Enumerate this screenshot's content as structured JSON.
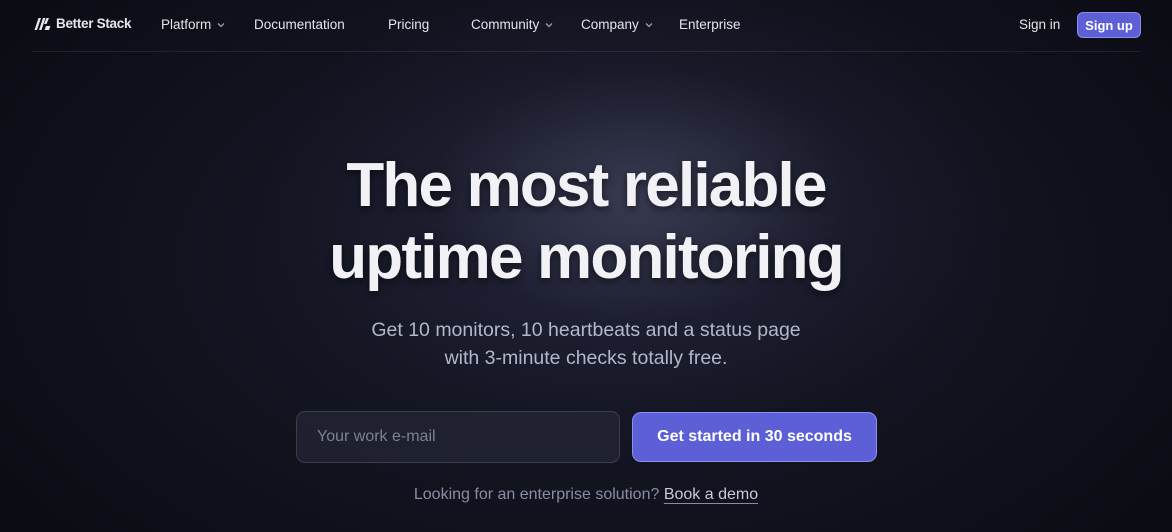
{
  "brand": {
    "name": "Better Stack",
    "logo_icon": "betterstack-logo-icon"
  },
  "nav": {
    "items": [
      {
        "label": "Platform",
        "has_dropdown": true
      },
      {
        "label": "Documentation",
        "has_dropdown": false
      },
      {
        "label": "Pricing",
        "has_dropdown": false
      },
      {
        "label": "Community",
        "has_dropdown": true
      },
      {
        "label": "Company",
        "has_dropdown": true
      },
      {
        "label": "Enterprise",
        "has_dropdown": false
      }
    ],
    "sign_in": "Sign in",
    "sign_up": "Sign up"
  },
  "hero": {
    "headline_line1": "The most reliable",
    "headline_line2": "uptime monitoring",
    "subtitle_line1": "Get 10 monitors, 10 heartbeats and a status page",
    "subtitle_line2": "with 3-minute checks totally free.",
    "email_placeholder": "Your work e-mail",
    "email_value": "",
    "cta_label": "Get started in 30 seconds",
    "enterprise_text": "Looking for an enterprise solution?",
    "demo_link": "Book a demo"
  },
  "colors": {
    "background": "#0b0c14",
    "accent": "#5d5fd6",
    "accent_border": "#8c8ef2",
    "text_primary": "#f1f1f6",
    "text_muted": "#b3b6cc"
  }
}
